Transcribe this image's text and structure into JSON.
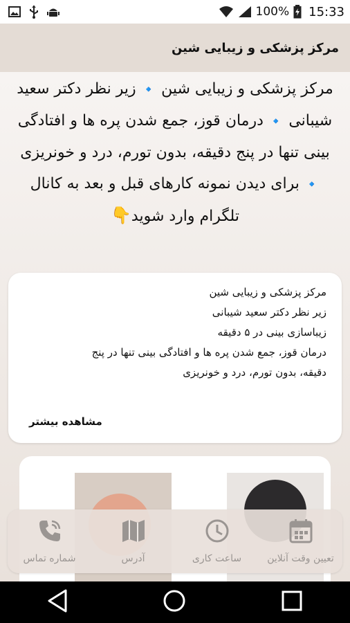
{
  "status_bar": {
    "left_icons": [
      "image-icon",
      "usb-icon",
      "android-icon"
    ],
    "battery_percent": "100%",
    "time": "15:33"
  },
  "app_bar": {
    "title": "مرکز پزشکی و زیبایی شین"
  },
  "intro": {
    "part1": "مرکز پزشکی و زیبایی شین",
    "part2": "زیر نظر دکتر سعید شیبانی",
    "part3": "درمان قوز، جمع شدن پره ها و افتادگی بینی تنها در پنج دقیقه، بدون تورم، درد و خونریزی",
    "part4": "برای دیدن نمونه کارهای قبل و بعد به کانال تلگرام وارد شوید",
    "diamond": "🔹",
    "pointing_emoji": "👇"
  },
  "card": {
    "lines": [
      "مرکز پزشکی و زیبایی شین",
      "زیر نظر دکتر سعید شیبانی",
      "زیباسازی بینی در ۵ دقیقه",
      "درمان قوز، جمع شدن پره ها و افتادگی بینی تنها در پنج",
      "دقیقه، بدون تورم، درد و خونریزی"
    ],
    "more_label": "مشاهده بیشتر"
  },
  "bottom_nav": [
    {
      "label": "تعیین وقت آنلاین",
      "icon": "calendar-icon"
    },
    {
      "label": "ساعت کاری",
      "icon": "clock-icon"
    },
    {
      "label": "آدرس",
      "icon": "map-icon"
    },
    {
      "label": "شماره تماس",
      "icon": "phone-icon"
    }
  ],
  "colors": {
    "accent_diamond": "#1e9be6",
    "app_bar": "#e4dcd5",
    "nav_icon": "#9a9592"
  }
}
